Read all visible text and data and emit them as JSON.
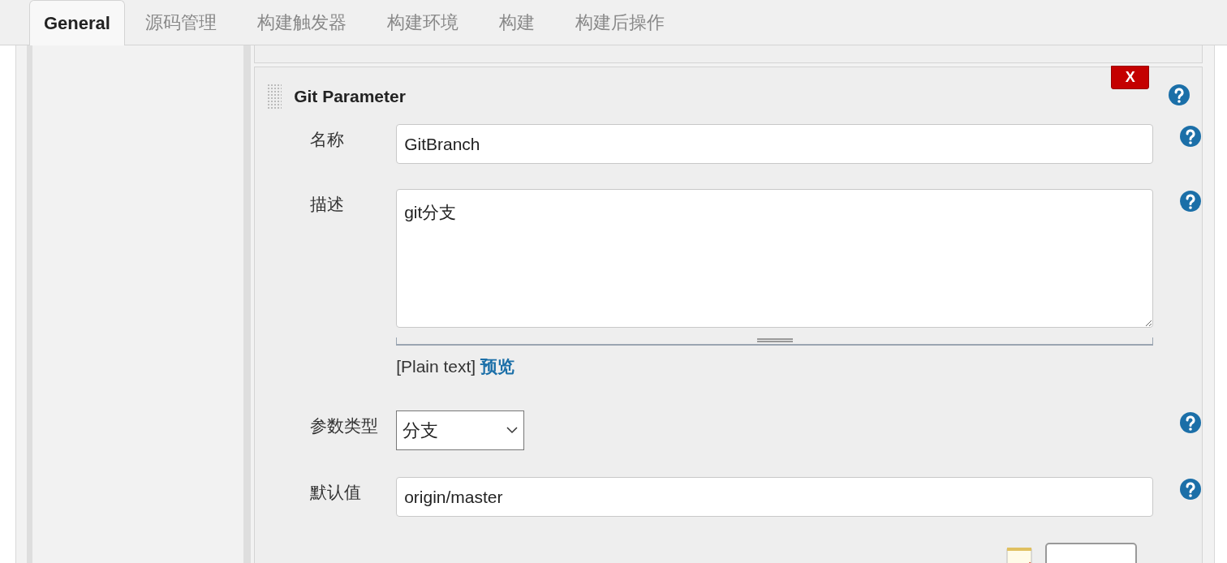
{
  "tabs": [
    {
      "label": "General",
      "selected": true
    },
    {
      "label": "源码管理",
      "selected": false
    },
    {
      "label": "构建触发器",
      "selected": false
    },
    {
      "label": "构建环境",
      "selected": false
    },
    {
      "label": "构建",
      "selected": false
    },
    {
      "label": "构建后操作",
      "selected": false
    }
  ],
  "section": {
    "title": "Git Parameter",
    "delete_button": "X",
    "fields": [
      {
        "kind": "text",
        "label": "名称",
        "value": "GitBranch"
      },
      {
        "kind": "textarea",
        "label": "描述",
        "value": "git分支",
        "format_note": "[Plain text]",
        "preview_link": "预览"
      },
      {
        "kind": "select",
        "label": "参数类型",
        "value": "分支"
      },
      {
        "kind": "text",
        "label": "默认值",
        "value": "origin/master"
      }
    ]
  }
}
